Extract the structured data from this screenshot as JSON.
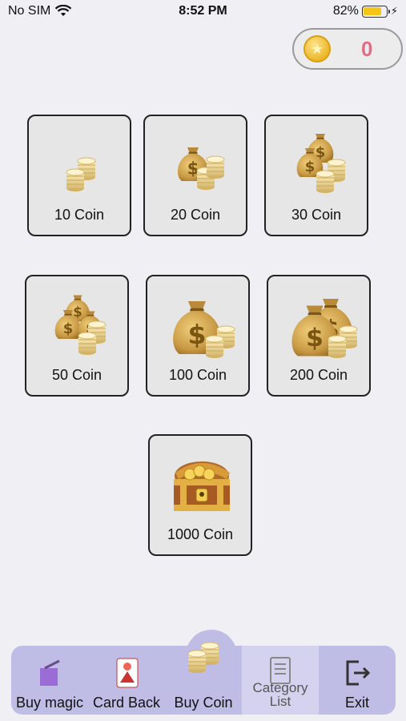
{
  "status_bar": {
    "carrier": "No SIM",
    "time": "8:52 PM",
    "battery_percent": "82%",
    "battery_level": 0.82
  },
  "coin_counter": {
    "icon": "star-coin-icon",
    "value": "0"
  },
  "packages": [
    {
      "label": "10 Coin",
      "icon": "coin-stack-icon"
    },
    {
      "label": "20 Coin",
      "icon": "money-bag-coins-icon"
    },
    {
      "label": "30 Coin",
      "icon": "two-money-bags-icon"
    },
    {
      "label": "50 Coin",
      "icon": "three-money-bags-icon"
    },
    {
      "label": "100 Coin",
      "icon": "large-money-bag-icon"
    },
    {
      "label": "200 Coin",
      "icon": "two-large-money-bags-icon"
    },
    {
      "label": "1000 Coin",
      "icon": "treasure-chest-icon"
    }
  ],
  "tabbar": {
    "tabs": [
      {
        "label": "Buy magic",
        "icon": "magic-box-icon"
      },
      {
        "label": "Card Back",
        "icon": "card-back-icon"
      },
      {
        "label": "Buy Coin",
        "icon": "coin-stack-icon"
      },
      {
        "label": "Category List",
        "label_visible_top": "Category",
        "label_visible_bottom": "List",
        "icon": "list-document-icon"
      },
      {
        "label": "Exit",
        "icon": "exit-icon"
      }
    ]
  },
  "colors": {
    "background": "#efeff4",
    "tile": "#e6e6e6",
    "tabbar": "#bfbce6",
    "coin_count": "#e36c86",
    "bag": "#caa050",
    "coin": "#f0d890"
  }
}
